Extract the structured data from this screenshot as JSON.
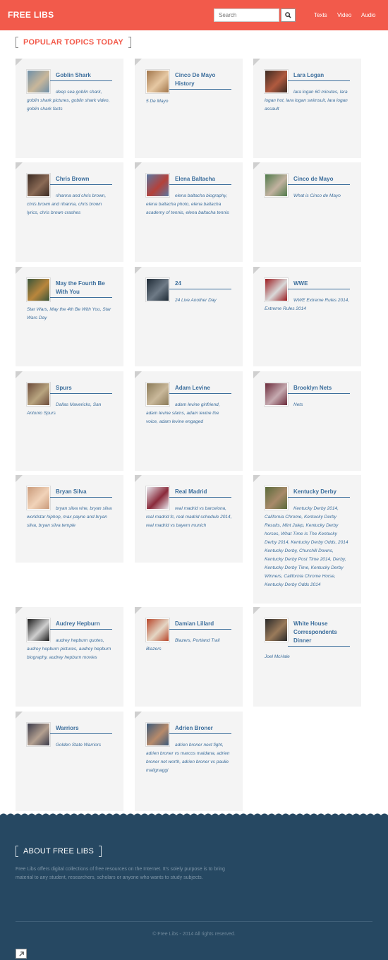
{
  "header": {
    "logo": "FREE LIBS",
    "search_placeholder": "Search",
    "nav": [
      "Texts",
      "Video",
      "Audio"
    ]
  },
  "section_title": "POPULAR TOPICS TODAY",
  "cards": [
    {
      "title": "Goblin Shark",
      "tags": "deep sea goblin shark, goblin shark pictures, goblin shark video, goblin shark facts",
      "thumb_colors": [
        "#6d8fa8",
        "#c9b79a"
      ]
    },
    {
      "title": "Cinco De Mayo History",
      "tags": "5 De Mayo",
      "thumb_colors": [
        "#a1754a",
        "#e6c8a3"
      ]
    },
    {
      "title": "Lara Logan",
      "tags": "lara logan 60 minutes, lara logan hot, lara logan swimsuit, lara logan assault",
      "thumb_colors": [
        "#3b2a22",
        "#b05a3f"
      ]
    },
    {
      "title": "Chris Brown",
      "tags": "rihanna and chris brown, chris brown and rihanna, chris brown lyrics, chris brown crashes",
      "thumb_colors": [
        "#3a2a22",
        "#8a6a55"
      ]
    },
    {
      "title": "Elena Baltacha",
      "tags": "elena baltacha biography, elena baltacha photo, elena baltacha academy of tennis, elena baltacha tennis",
      "thumb_colors": [
        "#5a78a2",
        "#b4413a"
      ]
    },
    {
      "title": "Cinco de Mayo",
      "tags": "What is Cinco de Mayo",
      "thumb_colors": [
        "#4f7a4a",
        "#c2b2a0"
      ]
    },
    {
      "title": "May the Fourth Be With You",
      "tags": "Star Wars, May the 4th Be With You, Star Wars Day",
      "thumb_colors": [
        "#39553a",
        "#b9863c"
      ]
    },
    {
      "title": "24",
      "tags": "24 Live Another Day",
      "thumb_colors": [
        "#1e2a35",
        "#6e7a86"
      ]
    },
    {
      "title": "WWE",
      "tags": "WWE Extreme Rules 2014, Extreme Rules 2014",
      "thumb_colors": [
        "#9b1b1f",
        "#d9d9d9"
      ]
    },
    {
      "title": "Spurs",
      "tags": "Dallas Mavericks, San Antonio Spurs",
      "thumb_colors": [
        "#6b4a3a",
        "#b8a47f"
      ]
    },
    {
      "title": "Adam Levine",
      "tags": "adam levine girlfriend, adam levine slams, adam levine the voice, adam levine engaged",
      "thumb_colors": [
        "#8a7a58",
        "#c9b89a"
      ]
    },
    {
      "title": "Brooklyn Nets",
      "tags": "Nets",
      "thumb_colors": [
        "#6a2a3a",
        "#c5aab0"
      ]
    },
    {
      "title": "Bryan Silva",
      "tags": "bryan silva vine, bryan silva worldstar hiphop, max payne and bryan silva, bryan silva temple",
      "thumb_colors": [
        "#c99a7a",
        "#f1d3b9"
      ]
    },
    {
      "title": "Real Madrid",
      "tags": "real madrid vs barcelona, real madrid fc, real madrid schedule 2014, real madrid vs bayern munich",
      "thumb_colors": [
        "#e8e8ee",
        "#8a2a3a"
      ]
    },
    {
      "title": "Kentucky Derby",
      "tags": "Kentucky Derby 2014, California Chrome, Kentucky Derby Results, Mint Julep, Kentucky Derby horses, What Time Is The Kentucky Derby 2014, Kentucky Derby Odds, 2014 Kentucky Derby, Churchill Downs, Kentucky Derby Post Time 2014, Derby, Kentucky Derby Time, Kentucky Derby Winners, California Chrome Horse, Kentucky Derby Odds 2014",
      "thumb_colors": [
        "#5a6a3a",
        "#a88a6a"
      ]
    },
    {
      "title": "Audrey Hepburn",
      "tags": "audrey hepburn quotes, audrey hepburn pictures, audrey hepburn biography, audrey hepburn movies",
      "thumb_colors": [
        "#1a1a1a",
        "#cfcfcf"
      ]
    },
    {
      "title": "Damian Lillard",
      "tags": "Blazers, Portland Trail Blazers",
      "thumb_colors": [
        "#b8462a",
        "#e4d6c4"
      ]
    },
    {
      "title": "White House Correspondents Dinner",
      "tags": "Joel McHale",
      "thumb_colors": [
        "#2a2a2a",
        "#9a7a5a"
      ]
    },
    {
      "title": "Warriors",
      "tags": "Golden State Warriors",
      "thumb_colors": [
        "#3a3a4a",
        "#b4a090"
      ]
    },
    {
      "title": "Adrien Broner",
      "tags": "adrien broner next fight, adrien broner vs marcos maidana, adrien broner net worth, adrien broner vs paulie malignaggi",
      "thumb_colors": [
        "#3c5a7a",
        "#b78a6a"
      ]
    }
  ],
  "footer": {
    "about_title": "ABOUT FREE LIBS",
    "about_text": "Free Libs offers digital collections of free resources on the Internet. It's solely purpose is to bring material to any student, researchers, scholars or anyone who wants to study subjects.",
    "copyright": "© Free Libs - 2014 All rights reserved."
  },
  "colors": {
    "brand": "#f25a4b",
    "link": "#3c6e9c",
    "footer_bg": "#264862"
  }
}
